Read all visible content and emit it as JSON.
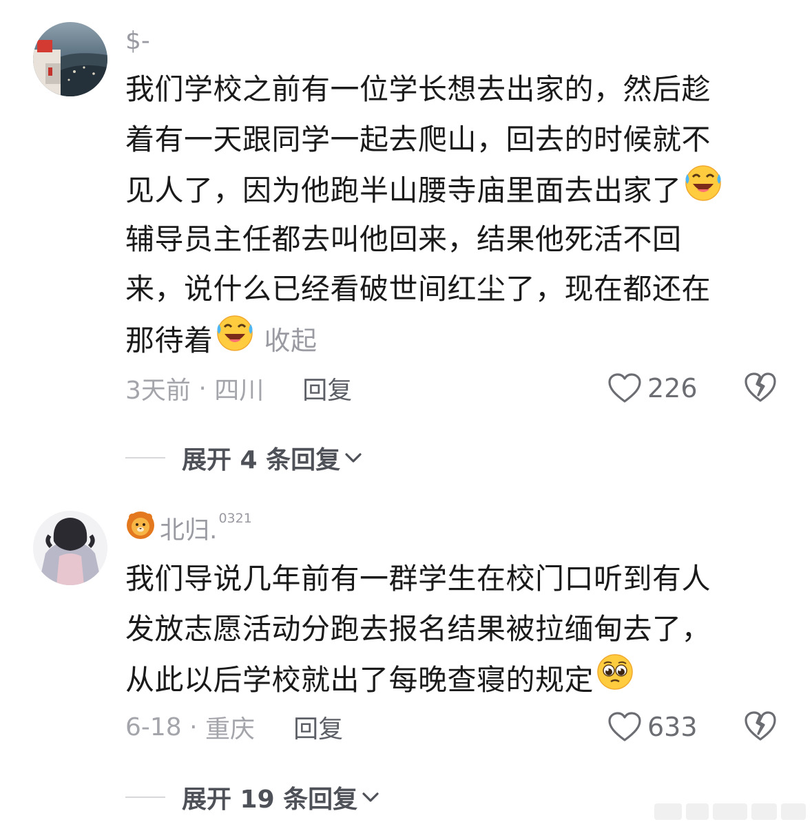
{
  "comments": [
    {
      "username": "$-",
      "username_badge": "",
      "text_lines": [
        "我们学校之前有一位学长想去出家的，然后趁",
        "着有一天跟同学一起去爬山，回去的时候就不",
        "见人了，因为他跑半山腰寺庙里面去出家了",
        "辅导员主任都去叫他回来，结果他死活不回",
        "来，说什么已经看破世间红尘了，现在都还在",
        "那待着"
      ],
      "emoji": "laughing-crying-emoji",
      "collapse_label": "收起",
      "time": "3天前",
      "location": "四川",
      "reply_label": "回复",
      "likes": "226",
      "expand_label": "展开 4 条回复"
    },
    {
      "username": "北归.",
      "username_badge": "0321",
      "username_emoji": "lion-face-emoji",
      "text_lines": [
        "我们导说几年前有一群学生在校门口听到有人",
        "发放志愿活动分跑去报名结果被拉缅甸去了，",
        "从此以后学校就出了每晚查寝的规定"
      ],
      "emoji": "pleading-face-emoji",
      "time": "6-18",
      "location": "重庆",
      "reply_label": "回复",
      "likes": "633",
      "expand_label": "展开 19 条回复"
    }
  ],
  "colors": {
    "primary_text": "#1a1a1a",
    "secondary_text": "#9a9ba2",
    "reply_text": "#5d5f66",
    "expand_text": "#4f5158",
    "background": "#ffffff"
  }
}
